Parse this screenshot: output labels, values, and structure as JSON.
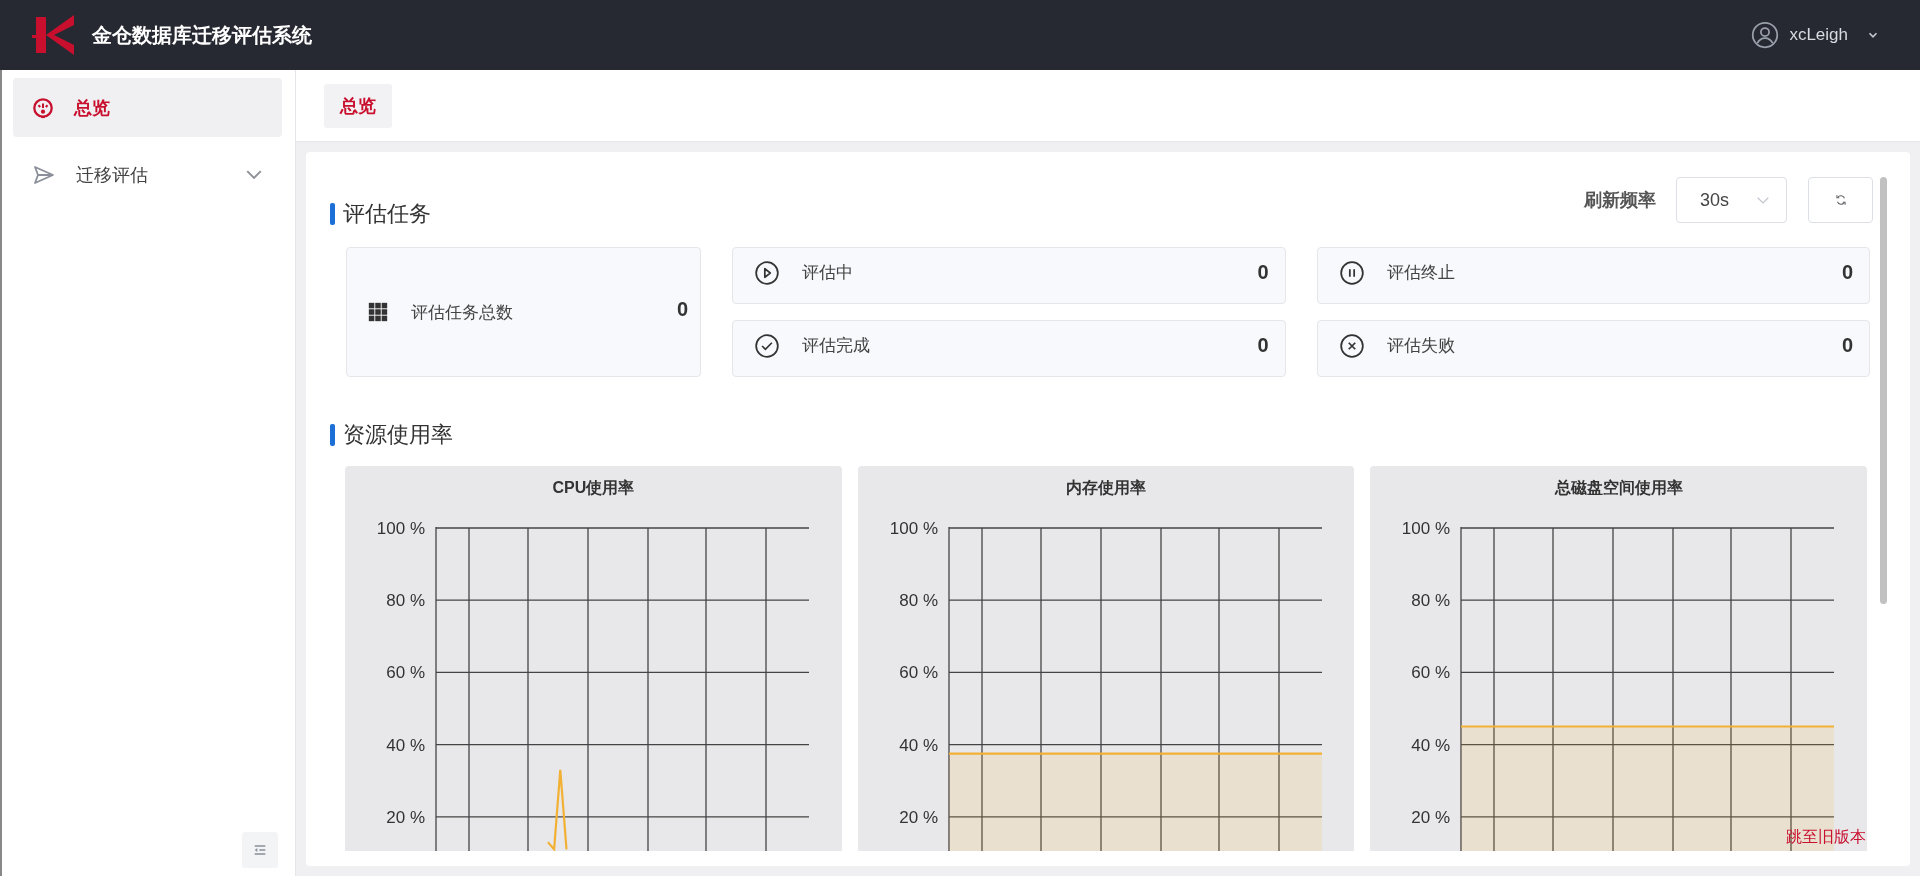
{
  "header": {
    "title": "金仓数据库迁移评估系统",
    "user": "xcLeigh"
  },
  "sidebar": {
    "items": [
      {
        "label": "总览",
        "selected": true
      },
      {
        "label": "迁移评估",
        "selected": false,
        "expanded": false
      }
    ]
  },
  "tabs": [
    {
      "label": "总览",
      "selected": true
    }
  ],
  "tasks": {
    "title": "评估任务",
    "refresh_label": "刷新频率",
    "refresh_interval": "30s",
    "total": {
      "label": "评估任务总数",
      "value": "0"
    },
    "statuses": [
      {
        "label": "评估中",
        "value": "0"
      },
      {
        "label": "评估终止",
        "value": "0"
      },
      {
        "label": "评估完成",
        "value": "0"
      },
      {
        "label": "评估失败",
        "value": "0"
      }
    ]
  },
  "resources": {
    "title": "资源使用率",
    "charts": [
      {
        "chart_data": {
          "type": "line",
          "title": "CPU使用率",
          "grid": true,
          "ylim": [
            10,
            100
          ],
          "yticks": [
            {
              "value": 20,
              "label": "20 %"
            },
            {
              "value": 40,
              "label": "40 %"
            },
            {
              "value": 60,
              "label": "60 %"
            },
            {
              "value": 80,
              "label": "80 %"
            },
            {
              "value": 100,
              "label": "100 %"
            }
          ],
          "series": [
            {
              "color": "#f2b134",
              "values": [
                null,
                null,
                null,
                null,
                null,
                null,
                null,
                null,
                null,
                null,
                null,
                null,
                null,
                null,
                null,
                null,
                null,
                null,
                13,
                11,
                33,
                11,
                null,
                null,
                null,
                null,
                null,
                null,
                null,
                null,
                null,
                null,
                null,
                null,
                null,
                null,
                null,
                null,
                null,
                null,
                null,
                null,
                null,
                null,
                null,
                null,
                null,
                null,
                null,
                null,
                null,
                null,
                null,
                null,
                null,
                null,
                null,
                null,
                null,
                null,
                null
              ]
            }
          ]
        }
      },
      {
        "chart_data": {
          "type": "area",
          "title": "内存使用率",
          "grid": true,
          "ylim": [
            10,
            100
          ],
          "yticks": [
            {
              "value": 20,
              "label": "20 %"
            },
            {
              "value": 40,
              "label": "40 %"
            },
            {
              "value": 60,
              "label": "60 %"
            },
            {
              "value": 80,
              "label": "80 %"
            },
            {
              "value": 100,
              "label": "100 %"
            }
          ],
          "series": [
            {
              "color": "#f2b134",
              "values": [
                37.5,
                37.5,
                37.5,
                37.5,
                37.5,
                37.5,
                37.5,
                37.5,
                37.5,
                37.5,
                37.5,
                37.5,
                37.5,
                37.5,
                37.5,
                37.5,
                37.5,
                37.5,
                37.5,
                37.5,
                37.5,
                37.5,
                37.5,
                37.5,
                37.5,
                37.5,
                37.5,
                37.5,
                37.5,
                37.5,
                37.5
              ]
            }
          ]
        }
      },
      {
        "chart_data": {
          "type": "area",
          "title": "总磁盘空间使用率",
          "grid": true,
          "ylim": [
            10,
            100
          ],
          "yticks": [
            {
              "value": 20,
              "label": "20 %"
            },
            {
              "value": 40,
              "label": "40 %"
            },
            {
              "value": 60,
              "label": "60 %"
            },
            {
              "value": 80,
              "label": "80 %"
            },
            {
              "value": 100,
              "label": "100 %"
            }
          ],
          "series": [
            {
              "color": "#f2b134",
              "values": [
                45,
                45,
                45,
                45,
                45,
                45,
                45,
                45,
                45,
                45,
                45,
                45,
                45,
                45,
                45,
                45,
                45,
                45,
                45,
                45,
                45,
                45,
                45,
                45,
                45,
                45,
                45,
                45,
                45,
                45,
                45
              ]
            }
          ]
        }
      }
    ]
  },
  "old_version_link": "跳至旧版本"
}
